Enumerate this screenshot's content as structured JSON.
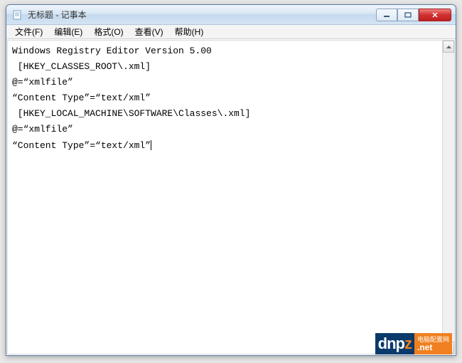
{
  "titlebar": {
    "title": "无标题 - 记事本"
  },
  "menubar": {
    "items": [
      {
        "label": "文件(F)"
      },
      {
        "label": "编辑(E)"
      },
      {
        "label": "格式(O)"
      },
      {
        "label": "查看(V)"
      },
      {
        "label": "帮助(H)"
      }
    ]
  },
  "content": {
    "lines": [
      "Windows Registry Editor Version 5.00",
      " [HKEY_CLASSES_ROOT\\.xml]",
      "@=“xmlfile”",
      "“Content Type”=“text/xml”",
      " [HKEY_LOCAL_MACHINE\\SOFTWARE\\Classes\\.xml]",
      "@=“xmlfile”",
      "“Content Type”=“text/xml”"
    ]
  },
  "watermark": {
    "brand": "dnp",
    "cn": "电脑配置网",
    "net": ".net"
  }
}
